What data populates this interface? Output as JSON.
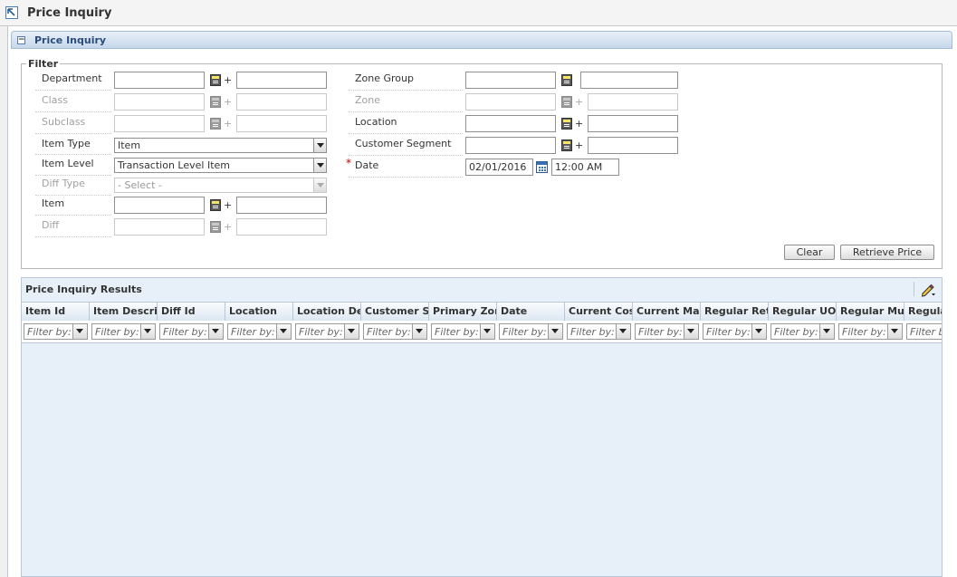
{
  "header": {
    "title": "Price Inquiry"
  },
  "section": {
    "title": "Price Inquiry",
    "toggle": "−"
  },
  "filter": {
    "legend": "Filter",
    "department": {
      "label": "Department",
      "value": "",
      "desc": ""
    },
    "class": {
      "label": "Class",
      "value": "",
      "desc": ""
    },
    "subclass": {
      "label": "Subclass",
      "value": "",
      "desc": ""
    },
    "item_type": {
      "label": "Item Type",
      "value": "Item"
    },
    "item_level": {
      "label": "Item Level",
      "value": "Transaction Level Item"
    },
    "diff_type": {
      "label": "Diff Type",
      "value": "- Select -"
    },
    "item": {
      "label": "Item",
      "value": "",
      "desc": ""
    },
    "diff": {
      "label": "Diff",
      "value": "",
      "desc": ""
    },
    "zone_group": {
      "label": "Zone Group",
      "value": "",
      "desc": ""
    },
    "zone": {
      "label": "Zone",
      "value": "",
      "desc": ""
    },
    "location": {
      "label": "Location",
      "value": "",
      "desc": ""
    },
    "customer_segment": {
      "label": "Customer Segment",
      "value": "",
      "desc": ""
    },
    "date": {
      "label": "Date",
      "required_mark": "*",
      "value": "02/01/2016",
      "time": "12:00 AM"
    },
    "plus": "+",
    "clear_label": "Clear",
    "retrieve_label": "Retrieve Price"
  },
  "results": {
    "title": "Price Inquiry Results",
    "filter_placeholder": "Filter by:",
    "columns": [
      "Item Id",
      "Item Description",
      "Diff Id",
      "Location",
      "Location Description",
      "Customer Segment",
      "Primary Zone",
      "Date",
      "Current Cost",
      "Current Markup",
      "Regular Retail",
      "Regular UOM",
      "Regular Multi",
      "Regular"
    ]
  },
  "icons": {
    "back": "maximize-arrow-icon",
    "lov": "list-of-values-icon",
    "calendar": "calendar-icon",
    "edit": "pencil-icon",
    "dropdown": "chevron-down-icon"
  },
  "colors": {
    "section_bar": "#c6d7ea",
    "results_bg": "#e7f0f9",
    "required": "#bb0000"
  }
}
